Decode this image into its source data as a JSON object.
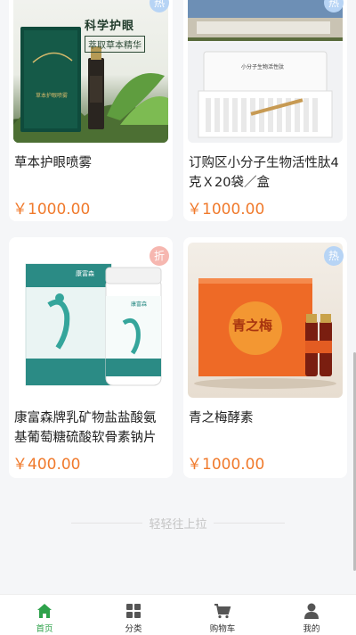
{
  "products": [
    {
      "title": "草本护眼喷雾",
      "price": "￥1000.00",
      "badge": "热",
      "badge_color": "#b7d4f5",
      "image": {
        "box_text_top": "科学护眼",
        "box_text_sub": "萃取草本精华",
        "box_label": "草本护眼喷雾"
      }
    },
    {
      "title": "订购区小分子生物活性肽4克Ｘ20袋／盒",
      "price": "￥1000.00",
      "badge": "热",
      "badge_color": "#b7d4f5",
      "image": {
        "box_label": "小分子生物活性肽"
      }
    },
    {
      "title": "康富森牌乳矿物盐盐酸氨基葡萄糖硫酸软骨素钠片",
      "price": "￥400.00",
      "badge": "折",
      "badge_color": "#f6b7b0",
      "image": {
        "brand": "康富森",
        "box_label": "康富森牌乳矿物盐盐酸氨基葡萄糖硫酸软骨素钠片",
        "bottle_label": "康富森"
      }
    },
    {
      "title": "青之梅酵素",
      "price": "￥1000.00",
      "badge": "热",
      "badge_color": "#b7d4f5",
      "image": {
        "box_label": "青之梅"
      }
    }
  ],
  "end_text": "轻轻往上拉",
  "tabbar": [
    {
      "label": "首页",
      "icon": "home-icon",
      "active": true
    },
    {
      "label": "分类",
      "icon": "category-grid-icon",
      "active": false
    },
    {
      "label": "购物车",
      "icon": "cart-icon",
      "active": false
    },
    {
      "label": "我的",
      "icon": "user-icon",
      "active": false
    }
  ],
  "colors": {
    "accent": "#2ea24b",
    "price": "#f07a2c",
    "hot_badge": "#b7d4f5",
    "discount_badge": "#f6b7b0"
  }
}
